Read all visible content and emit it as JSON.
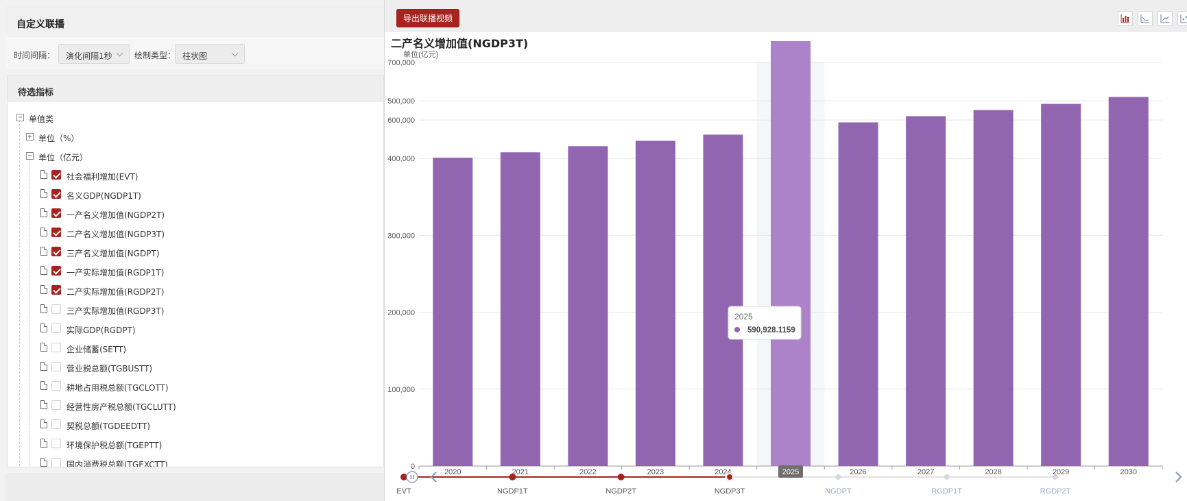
{
  "left": {
    "title": "自定义联播",
    "controls": {
      "interval_label": "时间间隔：",
      "interval_value": "演化间隔1秒",
      "type_label": "绘制类型：",
      "type_value": "柱状图"
    },
    "tree": {
      "header": "待选指标",
      "root_label": "单值类",
      "percent_group": "单位（%）",
      "yiyuan_group": "单位（亿元）",
      "items": [
        {
          "label": "社会福利增加(EVT)",
          "checked": true
        },
        {
          "label": "名义GDP(NGDP1T)",
          "checked": true
        },
        {
          "label": "一产名义增加值(NGDP2T)",
          "checked": true
        },
        {
          "label": "二产名义增加值(NGDP3T)",
          "checked": true
        },
        {
          "label": "三产名义增加值(NGDPT)",
          "checked": true
        },
        {
          "label": "一产实际增加值(RGDP1T)",
          "checked": true
        },
        {
          "label": "二产实际增加值(RGDP2T)",
          "checked": true
        },
        {
          "label": "三产实际增加值(RGDP3T)",
          "checked": false
        },
        {
          "label": "实际GDP(RGDPT)",
          "checked": false
        },
        {
          "label": "企业储蓄(SETT)",
          "checked": false
        },
        {
          "label": "营业税总额(TGBUSTT)",
          "checked": false
        },
        {
          "label": "耕地占用税总额(TGCLOTT)",
          "checked": false
        },
        {
          "label": "经营性房产税总额(TGCLUTT)",
          "checked": false
        },
        {
          "label": "契税总额(TGDEEDTT)",
          "checked": false
        },
        {
          "label": "环境保护税总额(TGEPTT)",
          "checked": false
        },
        {
          "label": "国内消费税总额(TGEXCTT)",
          "checked": false
        }
      ]
    }
  },
  "right": {
    "export_label": "导出联播视频",
    "toolbar_icons": [
      "bar-chart-icon",
      "line-chart-icon",
      "trend-icon",
      "scatter-icon"
    ],
    "chart_title": "二产名义增加值(NGDP3T)",
    "tooltip": {
      "year": "2025",
      "value": "590,928.1159"
    },
    "timeline": {
      "labels": [
        "EVT",
        "NGDP1T",
        "NGDP2T",
        "NGDP3T",
        "NGDPT",
        "RGDP1T",
        "RGDP2T"
      ],
      "current_index": 3
    }
  },
  "chart_data": {
    "type": "bar",
    "title": "二产名义增加值(NGDP3T)",
    "ylabel": "单位(亿元)",
    "categories": [
      "2020",
      "2021",
      "2022",
      "2023",
      "2024",
      "2025",
      "2026",
      "2027",
      "2028",
      "2029",
      "2030"
    ],
    "series": [
      {
        "values": [
          401000,
          408000,
          416000,
          423000,
          431000,
          590928.1159,
          447000,
          455000,
          463000,
          471000,
          480000
        ]
      }
    ],
    "highlight_index": 5,
    "y_ticks": [
      "0",
      "100,000",
      "200,000",
      "300,000",
      "400,000",
      "600,000",
      "500,000",
      "700,000"
    ],
    "y_tick_values": [
      0,
      100000,
      200000,
      300000,
      400000,
      450000,
      475000,
      525000
    ],
    "grid": true,
    "colors": {
      "bar": "#9265b0",
      "highlight": "#ac82c9",
      "accent": "#a8231f"
    }
  }
}
